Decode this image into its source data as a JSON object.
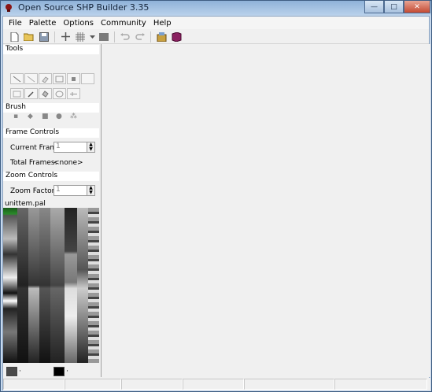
{
  "window": {
    "title": "Open Source SHP Builder 3.35",
    "controls": [
      "—",
      "□",
      "✕"
    ]
  },
  "menu": [
    "File",
    "Palette",
    "Options",
    "Community",
    "Help"
  ],
  "toolbar": {
    "icons": [
      "new-icon",
      "open-icon",
      "save-icon",
      "add-icon",
      "grid-icon",
      "dropdown-icon",
      "display-icon",
      "undo-icon",
      "redo-icon",
      "package-icon",
      "book-icon"
    ]
  },
  "panel": {
    "tools_label": "Tools",
    "brush_label": "Brush",
    "frame_controls_label": "Frame Controls",
    "current_frame_label": "Current Frame",
    "current_frame_value": "1",
    "total_frames_label": "Total Frames:",
    "total_frames_value": "<none>",
    "zoom_controls_label": "Zoom Controls",
    "zoom_factor_label": "Zoom Factor",
    "zoom_factor_value": "1",
    "palette_name": "unittem.pal",
    "swatch_left_label": "·",
    "swatch_right_label": "·",
    "swatch_left_color": "#4a4a4a",
    "swatch_right_color": "#000000"
  },
  "status": [
    "",
    "",
    "",
    "",
    "",
    ""
  ]
}
